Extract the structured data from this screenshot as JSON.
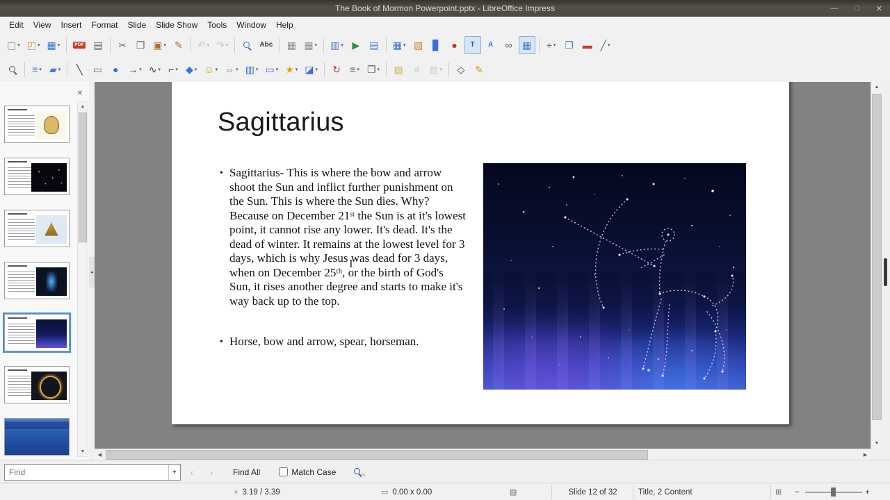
{
  "window": {
    "title": "The Book of Mormon Powerpoint.pptx - LibreOffice Impress",
    "controls": {
      "minimize": "—",
      "maximize": "□",
      "close": "✕"
    }
  },
  "menubar": {
    "items": [
      "Edit",
      "View",
      "Insert",
      "Format",
      "Slide",
      "Slide Show",
      "Tools",
      "Window",
      "Help"
    ]
  },
  "toolbars": {
    "standard": {
      "items": [
        {
          "name": "new-document",
          "glyph": "▢",
          "color": "#7a8aa0",
          "dd": true
        },
        {
          "name": "open-file",
          "glyph": "◰",
          "color": "#c9973b",
          "dd": true
        },
        {
          "name": "save",
          "glyph": "▦",
          "color": "#3a6fd8",
          "dd": true
        },
        {
          "sep": true
        },
        {
          "name": "export-pdf",
          "badge": "PDF",
          "color": "#cf3a2a"
        },
        {
          "name": "print",
          "glyph": "▤",
          "color": "#5a5f66"
        },
        {
          "sep": true
        },
        {
          "name": "cut",
          "glyph": "✂",
          "color": "#6a6f76"
        },
        {
          "name": "copy",
          "glyph": "❐",
          "color": "#6a6f76"
        },
        {
          "name": "paste",
          "glyph": "▣",
          "color": "#a8742f",
          "dd": true
        },
        {
          "name": "clone-formatting",
          "glyph": "✎",
          "color": "#b06a2a"
        },
        {
          "sep": true
        },
        {
          "name": "undo",
          "glyph": "↶",
          "color": "#8a8f96",
          "dd": true,
          "disabled": true
        },
        {
          "name": "redo",
          "glyph": "↷",
          "color": "#8a8f96",
          "dd": true,
          "disabled": true
        },
        {
          "sep": true
        },
        {
          "name": "find-and-replace",
          "shape": "mag",
          "color": "#3a6fd8"
        },
        {
          "name": "spelling",
          "text": "Abc",
          "color": "#333a42"
        },
        {
          "sep": true
        },
        {
          "name": "display-grid",
          "glyph": "▦",
          "color": "#8a9098"
        },
        {
          "name": "snap-to-grid",
          "glyph": "▦",
          "color": "#8a9098",
          "dd": true
        },
        {
          "sep": true
        },
        {
          "name": "display-views",
          "glyph": "▥",
          "color": "#4a7fd0",
          "dd": true
        },
        {
          "name": "start-from-first-slide",
          "glyph": "▶",
          "color": "#3a8a4a"
        },
        {
          "name": "master-slide",
          "glyph": "▤",
          "color": "#4a7fd0"
        },
        {
          "sep": true
        },
        {
          "name": "insert-table",
          "glyph": "▦",
          "color": "#3a6fd8",
          "dd": true
        },
        {
          "name": "insert-image",
          "glyph": "▨",
          "color": "#c87f35"
        },
        {
          "name": "insert-chart",
          "glyph": "▊",
          "color": "#3a6fd8"
        },
        {
          "name": "insert-media",
          "glyph": "●",
          "color": "#c0392b"
        },
        {
          "name": "insert-text-box",
          "text": "T",
          "color": "#2b579a",
          "active": true
        },
        {
          "name": "insert-fontwork",
          "text": "A",
          "color": "#3a6fd8"
        },
        {
          "name": "insert-hyperlink",
          "glyph": "∞",
          "color": "#5a5f66"
        },
        {
          "name": "display-snap-guides",
          "glyph": "▦",
          "color": "#4a7fd0",
          "active": true
        },
        {
          "sep": true
        },
        {
          "name": "new-slide",
          "glyph": "+",
          "color": "#3a8a3a",
          "dd": true
        },
        {
          "name": "duplicate-slide",
          "glyph": "❐",
          "color": "#4a7fd0"
        },
        {
          "name": "delete-slide",
          "glyph": "▬",
          "color": "#cf3a2a"
        },
        {
          "name": "insert-line-arrow",
          "glyph": "╱",
          "color": "#3a8a3a",
          "dd": true
        }
      ]
    },
    "drawing": {
      "items": [
        {
          "name": "zoom-pan",
          "shape": "mag",
          "color": "#555555"
        },
        {
          "sep": true
        },
        {
          "name": "line-style",
          "glyph": "≡",
          "color": "#4a7fd0",
          "dd": true
        },
        {
          "name": "fill-color",
          "glyph": "▰",
          "color": "#4a7fd0",
          "dd": true
        },
        {
          "sep": true
        },
        {
          "name": "insert-line",
          "glyph": "╲",
          "color": "#3a3f46"
        },
        {
          "name": "rectangle",
          "glyph": "▭",
          "color": "#4a8a3a"
        },
        {
          "name": "ellipse",
          "glyph": "●",
          "color": "#3a6fd8"
        },
        {
          "name": "lines-and-arrows",
          "glyph": "→",
          "color": "#3a3f46",
          "dd": true
        },
        {
          "name": "curves-and-polygons",
          "glyph": "∿",
          "color": "#3a3f46",
          "dd": true
        },
        {
          "name": "connectors",
          "glyph": "⌐",
          "color": "#3a3f46",
          "dd": true
        },
        {
          "name": "basic-shapes",
          "glyph": "◆",
          "color": "#3a6fd8",
          "dd": true
        },
        {
          "name": "symbol-shapes",
          "glyph": "☺",
          "color": "#d79b00",
          "dd": true
        },
        {
          "name": "block-arrows",
          "glyph": "⇔",
          "color": "#3a6fd8",
          "dd": true
        },
        {
          "name": "flowchart-shapes",
          "glyph": "▥",
          "color": "#3a6fd8",
          "dd": true
        },
        {
          "name": "callout-shapes",
          "glyph": "▭",
          "color": "#3a6fd8",
          "dd": true
        },
        {
          "name": "star-shapes",
          "glyph": "★",
          "color": "#d7a500",
          "dd": true
        },
        {
          "name": "3d-objects",
          "glyph": "◪",
          "color": "#3a6fd8",
          "dd": true
        },
        {
          "sep": true
        },
        {
          "name": "rotate",
          "glyph": "↻",
          "color": "#c0392b"
        },
        {
          "name": "align-objects",
          "glyph": "≡",
          "color": "#5a5f66",
          "dd": true
        },
        {
          "name": "arrange",
          "glyph": "❐",
          "color": "#5a5f66",
          "dd": true
        },
        {
          "sep": true
        },
        {
          "name": "shadow",
          "glyph": "▨",
          "color": "#d0b050"
        },
        {
          "name": "crop-image",
          "glyph": "#",
          "color": "#9aa0a8",
          "disabled": true
        },
        {
          "name": "image-filter",
          "glyph": "▥",
          "color": "#9aa0a8",
          "disabled": true,
          "dd": true
        },
        {
          "sep": true
        },
        {
          "name": "edit-points",
          "glyph": "◇",
          "color": "#3a3f46"
        },
        {
          "name": "glue-points",
          "glyph": "✎",
          "color": "#d79b00"
        }
      ]
    }
  },
  "slide_panel": {
    "close": "✕",
    "thumbnails": [
      {
        "variant": "leo"
      },
      {
        "variant": "virgo"
      },
      {
        "variant": "libra"
      },
      {
        "variant": "scorpio"
      },
      {
        "variant": "sagittarius",
        "selected": true
      },
      {
        "variant": "capricorn"
      },
      {
        "variant": "blue-title"
      }
    ]
  },
  "slide": {
    "title": "Sagittarius",
    "bullets": [
      "Sagittarius- This is where the bow and arrow shoot the Sun and inflict further punishment on the Sun. This is where the Sun dies. Why? Because on December 21ˢᵗ the Sun is at it's lowest point, it cannot rise any lower. It's dead. It's the dead of winter. It remains at the lowest level for 3 days, which is why Jesus was dead for 3 days, when on December 25ᵗʰ, or the birth of God's Sun, it rises another degree and starts to make it's way back up to the top.",
      "Horse, bow and arrow, spear, horseman."
    ]
  },
  "find_toolbar": {
    "placeholder": "Find",
    "dropdown": "▾",
    "prev": "‹",
    "next": "›",
    "find_all": "Find All",
    "match_case": "Match Case"
  },
  "statusbar": {
    "cursor_position": "3.19 / 3.39",
    "object_size": "0.00 x 0.00",
    "slide_info": "Slide 12 of 32",
    "layout_name": "Title, 2 Content",
    "zoom_minus": "−",
    "zoom_plus": "+",
    "icons": {
      "cursor_position": "+",
      "object_size": "▭",
      "modified": "▤",
      "zoom_fit": "⊞"
    }
  },
  "scrollbars": {
    "up": "▲",
    "down": "▼",
    "left": "◀",
    "right": "▶"
  }
}
